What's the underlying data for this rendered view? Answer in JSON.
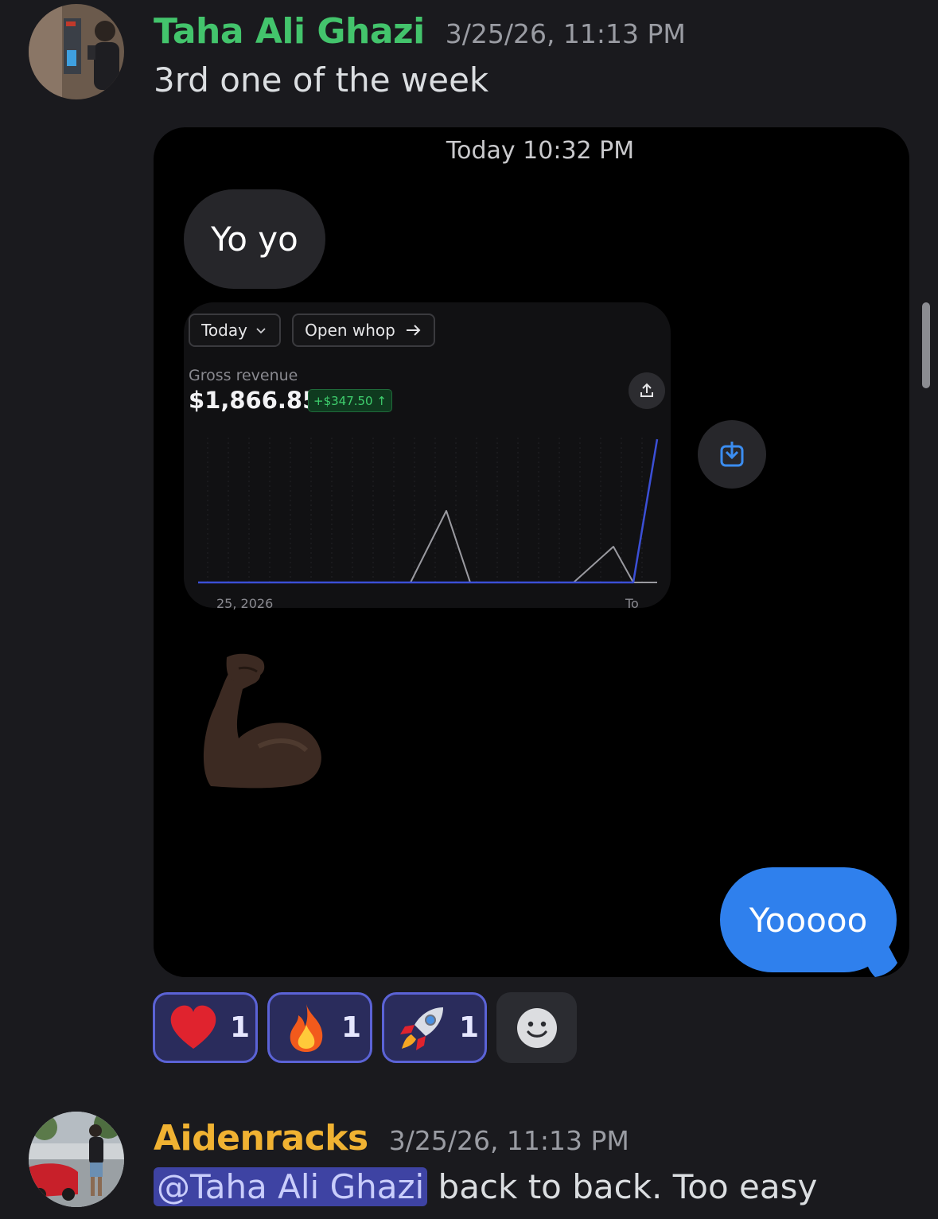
{
  "messages": [
    {
      "author": "Taha Ali Ghazi",
      "author_color": "#43c46c",
      "timestamp": "3/25/26, 11:13 PM",
      "text": "3rd one of the week",
      "attachment": {
        "time": "Today 10:32 PM",
        "bubble_left": "Yo yo",
        "dashboard": {
          "period_label": "Today",
          "open_label": "Open whop",
          "gross_label": "Gross revenue",
          "gross_value": "$1,866.85",
          "delta": "+$347.50 ↑",
          "axis_left": "25, 2026",
          "axis_right": "To"
        },
        "emoji": "flexed-biceps",
        "bubble_right": "Yooooo"
      },
      "reactions": [
        {
          "emoji": "heart",
          "count": "1"
        },
        {
          "emoji": "fire",
          "count": "1"
        },
        {
          "emoji": "rocket",
          "count": "1"
        }
      ]
    },
    {
      "author": "Aidenracks",
      "author_color": "#f0b232",
      "timestamp": "3/25/26, 11:13 PM",
      "mention": "@Taha Ali Ghazi",
      "text": " back to back. Too easy"
    }
  ],
  "chart_data": {
    "type": "line",
    "series": [
      {
        "values": [
          0,
          0,
          0,
          0,
          0,
          0,
          0,
          0,
          0,
          0,
          0,
          0,
          1
        ]
      },
      {
        "values": [
          0,
          0,
          0,
          0,
          0,
          0,
          0.5,
          0,
          0,
          0,
          0.25,
          0,
          0
        ]
      }
    ],
    "colors": [
      "#3b4fd6",
      "#9a9aa0"
    ]
  }
}
